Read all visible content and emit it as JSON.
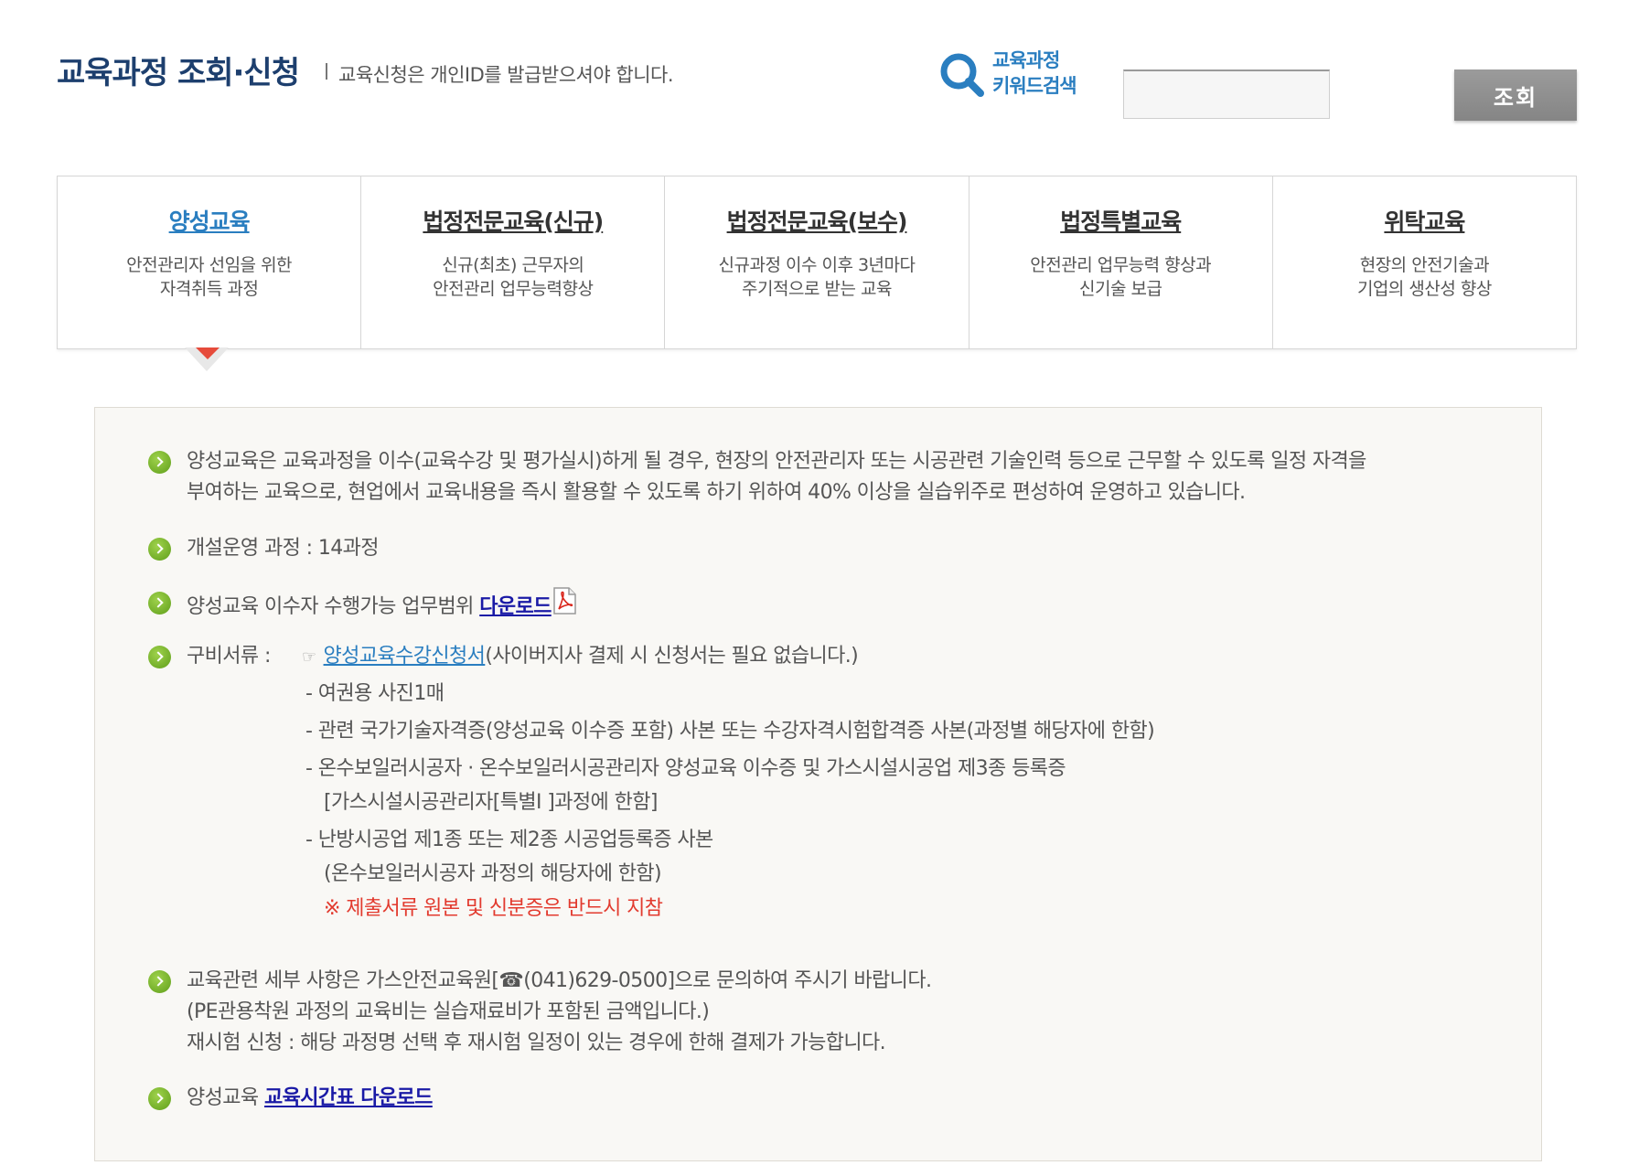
{
  "header": {
    "title": "교육과정 조회·신청",
    "notice": "교육신청은 개인ID를 발급받으셔야 합니다."
  },
  "search": {
    "label_line1": "교육과정",
    "label_line2": "키워드검색",
    "value": "",
    "button_label": "조회"
  },
  "tabs": [
    {
      "title": "양성교육",
      "desc1": "안전관리자 선임을 위한",
      "desc2": "자격취득 과정",
      "active": true
    },
    {
      "title": "법정전문교육(신규)",
      "desc1": "신규(최초) 근무자의",
      "desc2": "안전관리 업무능력향상",
      "active": false
    },
    {
      "title": "법정전문교육(보수)",
      "desc1": "신규과정 이수 이후 3년마다",
      "desc2": "주기적으로 받는 교육",
      "active": false
    },
    {
      "title": "법정특별교육",
      "desc1": "안전관리 업무능력 향상과",
      "desc2": "신기술 보급",
      "active": false
    },
    {
      "title": "위탁교육",
      "desc1": "현장의 안전기술과",
      "desc2": "기업의 생산성 향상",
      "active": false
    }
  ],
  "info": {
    "intro_line1": "양성교육은 교육과정을 이수(교육수강 및 평가실시)하게 될 경우, 현장의 안전관리자 또는 시공관련 기술인력 등으로 근무할 수 있도록 일정 자격을",
    "intro_line2": "부여하는 교육으로, 현업에서 교육내용을 즉시 활용할 수 있도록 하기 위하여 40% 이상을 실습위주로 편성하여 운영하고 있습니다.",
    "courses": "개설운영 과정 : 14과정",
    "scope_prefix": "양성교육 이수자 수행가능 업무범위",
    "scope_link": "다운로드",
    "docs_label": "구비서류 :",
    "docs_hand": "☞",
    "docs_form_link": "양성교육수강신청서",
    "docs_form_note": "(사이버지사 결제 시 신청서는 필요 없습니다.)",
    "doc1": "-  여권용 사진1매",
    "doc2": "-  관련 국가기술자격증(양성교육 이수증 포함) 사본 또는 수강자격시험합격증 사본(과정별 해당자에 한함)",
    "doc3_line1": "-  온수보일러시공자 · 온수보일러시공관리자 양성교육 이수증 및 가스시설시공업 제3종 등록증",
    "doc3_line2": "[가스시설시공관리자[특별I ]과정에 한함]",
    "doc4_line1": "-  난방시공업 제1종 또는 제2종 시공업등록증 사본",
    "doc4_line2": "(온수보일러시공자 과정의 해당자에 한함)",
    "doc_warning": "※ 제출서류 원본 및 신분증은 반드시 지참",
    "contact_line1": "교육관련 세부 사항은 가스안전교육원[☎(041)629-0500]으로 문의하여 주시기 바랍니다.",
    "contact_line2": "(PE관용착원 과정의 교육비는 실습재료비가 포함된 금액입니다.)",
    "contact_line3": "재시험 신청 : 해당 과정명 선택 후 재시험 일정이 있는 경우에 한해 결제가 가능합니다.",
    "timetable_prefix": "양성교육",
    "timetable_link": "교육시간표 다운로드"
  },
  "colors": {
    "title": "#1d3f6e",
    "accent": "#2a7ec0",
    "link": "#1a1aa6",
    "warning": "#e23a2e",
    "bullet": "#6aab22"
  }
}
